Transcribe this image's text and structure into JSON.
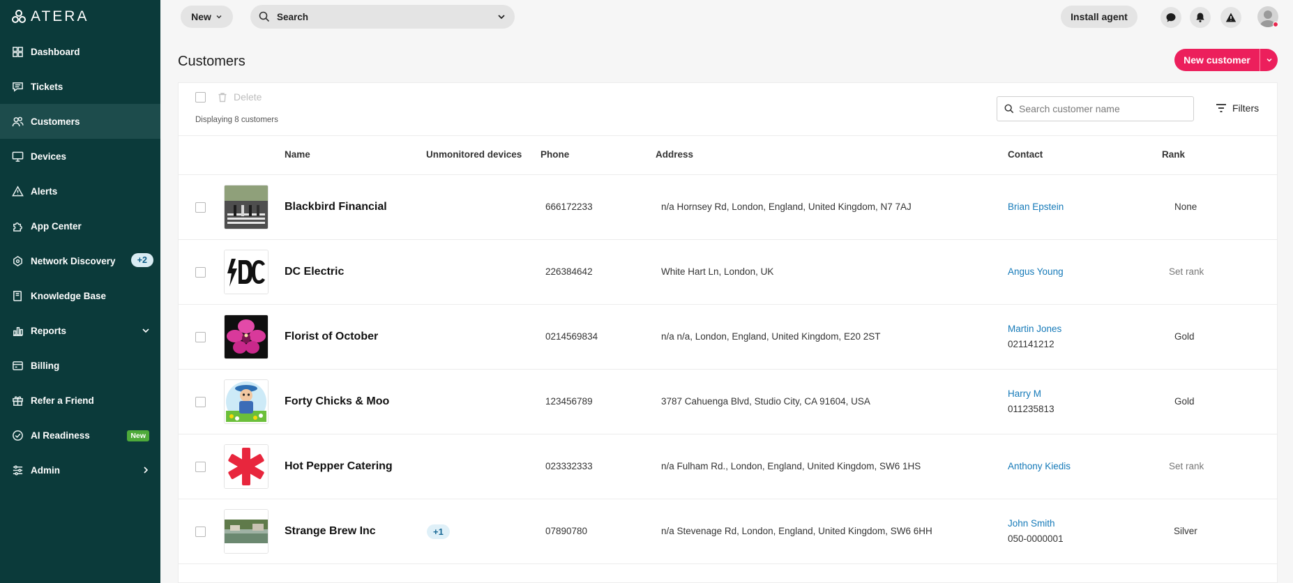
{
  "app": {
    "logo_text": "ATERA"
  },
  "sidebar": {
    "items": [
      {
        "label": "Dashboard",
        "icon": "dashboard-icon"
      },
      {
        "label": "Tickets",
        "icon": "tickets-icon"
      },
      {
        "label": "Customers",
        "icon": "customers-icon",
        "active": true
      },
      {
        "label": "Devices",
        "icon": "devices-icon"
      },
      {
        "label": "Alerts",
        "icon": "alerts-icon"
      },
      {
        "label": "App Center",
        "icon": "puzzle-icon"
      },
      {
        "label": "Network Discovery",
        "icon": "network-discovery-icon",
        "badge": "+2"
      },
      {
        "label": "Knowledge Base",
        "icon": "knowledge-base-icon"
      },
      {
        "label": "Reports",
        "icon": "reports-icon",
        "chevron": "down"
      },
      {
        "label": "Billing",
        "icon": "billing-icon"
      },
      {
        "label": "Refer a Friend",
        "icon": "gift-icon"
      },
      {
        "label": "AI Readiness",
        "icon": "ai-readiness-icon",
        "tag": "New"
      },
      {
        "label": "Admin",
        "icon": "admin-icon",
        "chevron": "right"
      }
    ]
  },
  "topbar": {
    "new_label": "New",
    "search_label": "Search",
    "install_agent_label": "Install agent"
  },
  "page": {
    "title": "Customers",
    "new_customer_label": "New customer"
  },
  "toolbar": {
    "delete_label": "Delete",
    "displaying_text": "Displaying 8 customers",
    "search_placeholder": "Search customer name",
    "filters_label": "Filters"
  },
  "table": {
    "headers": {
      "name": "Name",
      "unmonitored": "Unmonitored devices",
      "phone": "Phone",
      "address": "Address",
      "contact": "Contact",
      "rank": "Rank"
    },
    "rows": [
      {
        "name": "Blackbird Financial",
        "unmonitored": "",
        "phone": "666172233",
        "address": "n/a Hornsey Rd, London, England, United Kingdom, N7 7AJ",
        "contact": "Brian Epstein",
        "contact_phone": "",
        "rank": "None",
        "thumb": "crosswalk-photo"
      },
      {
        "name": "DC Electric",
        "unmonitored": "",
        "phone": "226384642",
        "address": "White Hart Ln, London, UK",
        "contact": "Angus Young",
        "contact_phone": "",
        "rank": "Set rank",
        "thumb": "dc-logo"
      },
      {
        "name": "Florist of October",
        "unmonitored": "",
        "phone": "0214569834",
        "address": "n/a n/a, London, England, United Kingdom, E20 2ST",
        "contact": "Martin Jones",
        "contact_phone": "021141212",
        "rank": "Gold",
        "thumb": "orchid-photo"
      },
      {
        "name": "Forty Chicks & Moo",
        "unmonitored": "",
        "phone": "123456789",
        "address": "3787 Cahuenga Blvd, Studio City, CA 91604, USA",
        "contact": "Harry M",
        "contact_phone": "011235813",
        "rank": "Gold",
        "thumb": "farmer-cartoon"
      },
      {
        "name": "Hot Pepper Catering",
        "unmonitored": "",
        "phone": "023332333",
        "address": "n/a Fulham Rd., London, England, United Kingdom, SW6 1HS",
        "contact": "Anthony Kiedis",
        "contact_phone": "",
        "rank": "Set rank",
        "thumb": "asterisk-logo"
      },
      {
        "name": "Strange Brew Inc",
        "unmonitored": "+1",
        "phone": "07890780",
        "address": "n/a Stevenage Rd, London, England, United Kingdom, SW6 6HH",
        "contact": "John Smith",
        "contact_phone": "050-0000001",
        "rank": "Silver",
        "thumb": "river-photo"
      }
    ]
  },
  "colors": {
    "sidebar_bg": "#0b3a3a",
    "sidebar_active": "#1d4c4c",
    "primary_pink": "#ec1f5c",
    "link_blue": "#1479b8",
    "new_tag_green": "#4eaa3a"
  }
}
